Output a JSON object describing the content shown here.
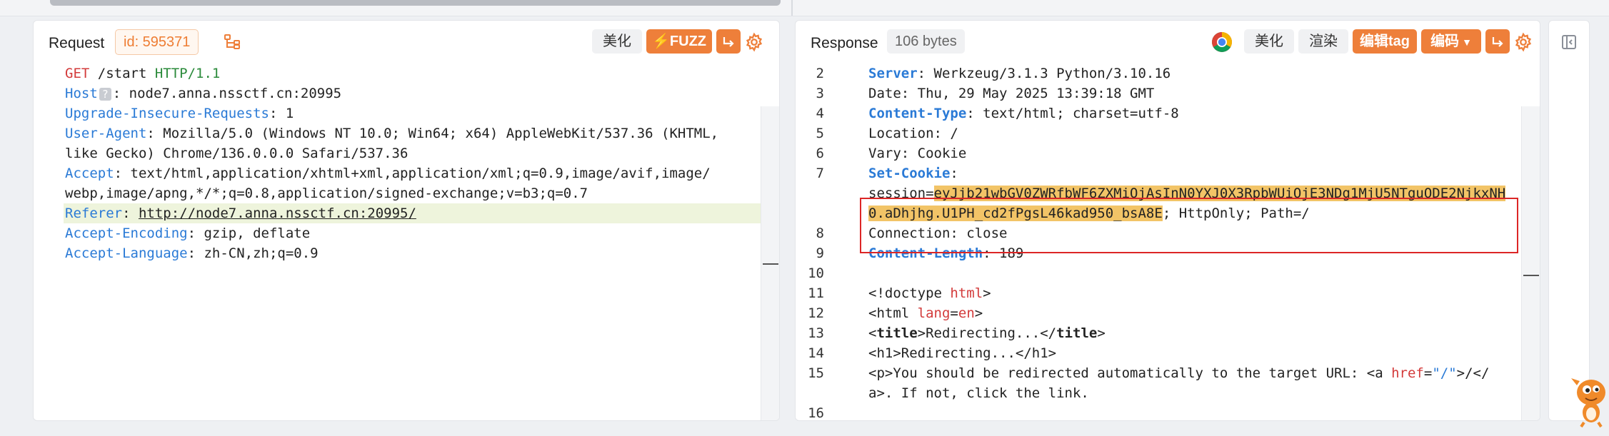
{
  "request": {
    "title": "Request",
    "id_badge": "id: 595371",
    "btn_beautify": "美化",
    "btn_fuzz": "FUZZ",
    "lines": [
      {
        "parts": [
          {
            "t": "GET",
            "c": "k-red"
          },
          {
            "t": " /start ",
            "c": "k-dark"
          },
          {
            "t": "HTTP/1.1",
            "c": "k-green"
          }
        ]
      },
      {
        "parts": [
          {
            "t": "Host",
            "c": "k-blue"
          },
          {
            "t": "?",
            "c": "qmark"
          },
          {
            "t": ": node7.anna.nssctf.cn:20995",
            "c": "k-dark"
          }
        ]
      },
      {
        "parts": [
          {
            "t": "Upgrade-Insecure-Requests",
            "c": "k-blue"
          },
          {
            "t": ": 1",
            "c": "k-dark"
          }
        ]
      },
      {
        "parts": [
          {
            "t": "User-Agent",
            "c": "k-blue"
          },
          {
            "t": ": Mozilla/5.0 (Windows NT 10.0; Win64; x64) AppleWebKit/537.36 (KHTML,",
            "c": "k-dark"
          }
        ]
      },
      {
        "parts": [
          {
            "t": "like Gecko) Chrome/136.0.0.0 Safari/537.36",
            "c": "k-dark"
          }
        ]
      },
      {
        "parts": [
          {
            "t": "Accept",
            "c": "k-blue"
          },
          {
            "t": ": text/html,application/xhtml+xml,application/xml;q=0.9,image/avif,image/",
            "c": "k-dark"
          }
        ]
      },
      {
        "parts": [
          {
            "t": "webp,image/apng,*/*;q=0.8,application/signed-exchange;v=b3;q=0.7",
            "c": "k-dark"
          }
        ]
      },
      {
        "parts": [
          {
            "t": "Referer",
            "c": "k-blue"
          },
          {
            "t": ": ",
            "c": "k-dark"
          },
          {
            "t": "http://node7.anna.nssctf.cn:20995/",
            "c": "k-dark underline"
          }
        ]
      },
      {
        "parts": [
          {
            "t": "Accept-Encoding",
            "c": "k-blue"
          },
          {
            "t": ": gzip, deflate",
            "c": "k-dark"
          }
        ]
      },
      {
        "parts": [
          {
            "t": "Accept-Language",
            "c": "k-blue"
          },
          {
            "t": ": zh-CN,zh;q=0.9",
            "c": "k-dark"
          }
        ]
      }
    ]
  },
  "response": {
    "title": "Response",
    "bytes_badge": "106 bytes",
    "btn_beautify": "美化",
    "btn_render": "渲染",
    "btn_edit_tag": "编辑tag",
    "btn_encode": "编码",
    "lines": [
      {
        "n": "2",
        "parts": [
          {
            "t": "Server",
            "c": "k-bold-blue"
          },
          {
            "t": ": Werkzeug/3.1.3 Python/3.10.16",
            "c": "k-dark"
          }
        ]
      },
      {
        "n": "3",
        "parts": [
          {
            "t": "Date: Thu, 29 May 2025 13:39:18 GMT",
            "c": "k-dark"
          }
        ]
      },
      {
        "n": "4",
        "parts": [
          {
            "t": "Content-Type",
            "c": "k-bold-blue"
          },
          {
            "t": ": text/html; charset=utf-8",
            "c": "k-dark"
          }
        ]
      },
      {
        "n": "5",
        "parts": [
          {
            "t": "Location: /",
            "c": "k-dark"
          }
        ]
      },
      {
        "n": "6",
        "parts": [
          {
            "t": "Vary: Cookie",
            "c": "k-dark"
          }
        ]
      },
      {
        "n": "7",
        "parts": [
          {
            "t": "Set-Cookie",
            "c": "k-bold-blue"
          },
          {
            "t": ":",
            "c": "k-dark"
          }
        ]
      },
      {
        "n": "",
        "parts": [
          {
            "t": "session=",
            "c": "k-dark"
          },
          {
            "t": "eyJjb21wbGV0ZWRfbWF6ZXMiOjAsInN0YXJ0X3RpbWUiOjE3NDg1MjU5NTguODE2NjkxNH",
            "c": "k-dark hl"
          }
        ]
      },
      {
        "n": "",
        "parts": [
          {
            "t": "0.aDhjhg.U1PH_cd2fPgsL46kad950_bsA8E",
            "c": "k-dark hl"
          },
          {
            "t": "; HttpOnly; Path=/",
            "c": "k-dark"
          }
        ]
      },
      {
        "n": "8",
        "parts": [
          {
            "t": "Connection: close",
            "c": "k-dark"
          }
        ]
      },
      {
        "n": "9",
        "parts": [
          {
            "t": "Content-Length",
            "c": "k-bold-blue"
          },
          {
            "t": ": 189",
            "c": "k-dark"
          }
        ]
      },
      {
        "n": "10",
        "parts": []
      },
      {
        "n": "11",
        "parts": [
          {
            "t": "<!doctype ",
            "c": "k-dark"
          },
          {
            "t": "html",
            "c": "k-red"
          },
          {
            "t": ">",
            "c": "k-dark"
          }
        ]
      },
      {
        "n": "12",
        "parts": [
          {
            "t": "<",
            "c": "k-dark"
          },
          {
            "t": "html ",
            "c": "k-dark"
          },
          {
            "t": "lang",
            "c": "k-red"
          },
          {
            "t": "=",
            "c": "k-dark"
          },
          {
            "t": "en",
            "c": "k-red"
          },
          {
            "t": ">",
            "c": "k-dark"
          }
        ]
      },
      {
        "n": "13",
        "parts": [
          {
            "t": "<",
            "c": "k-dark"
          },
          {
            "t": "title",
            "c": "k-dark bold"
          },
          {
            "t": ">Redirecting...</",
            "c": "k-dark"
          },
          {
            "t": "title",
            "c": "k-dark bold"
          },
          {
            "t": ">",
            "c": "k-dark"
          }
        ]
      },
      {
        "n": "14",
        "parts": [
          {
            "t": "<h1>Redirecting...</h1>",
            "c": "k-dark"
          }
        ]
      },
      {
        "n": "15",
        "parts": [
          {
            "t": "<p>You should be redirected automatically to the target URL: <a ",
            "c": "k-dark"
          },
          {
            "t": "href",
            "c": "k-red"
          },
          {
            "t": "=",
            "c": "k-dark"
          },
          {
            "t": "\"/\"",
            "c": "k-blue"
          },
          {
            "t": ">/</",
            "c": "k-dark"
          }
        ]
      },
      {
        "n": "",
        "parts": [
          {
            "t": "a>. If not, click the link.",
            "c": "k-dark"
          }
        ]
      },
      {
        "n": "16",
        "parts": []
      }
    ]
  },
  "icons": {
    "tree": "tree-icon",
    "fuzz_bolt": "bolt-icon",
    "wrap": "wrap-icon",
    "gear": "gear-icon",
    "chrome": "chrome-icon",
    "panel_toggle": "panel-toggle-icon",
    "mascot": "mascot-icon"
  },
  "colors": {
    "accent": "#ee7f3a",
    "highlight": "#f2c467",
    "box": "#dc2626"
  }
}
